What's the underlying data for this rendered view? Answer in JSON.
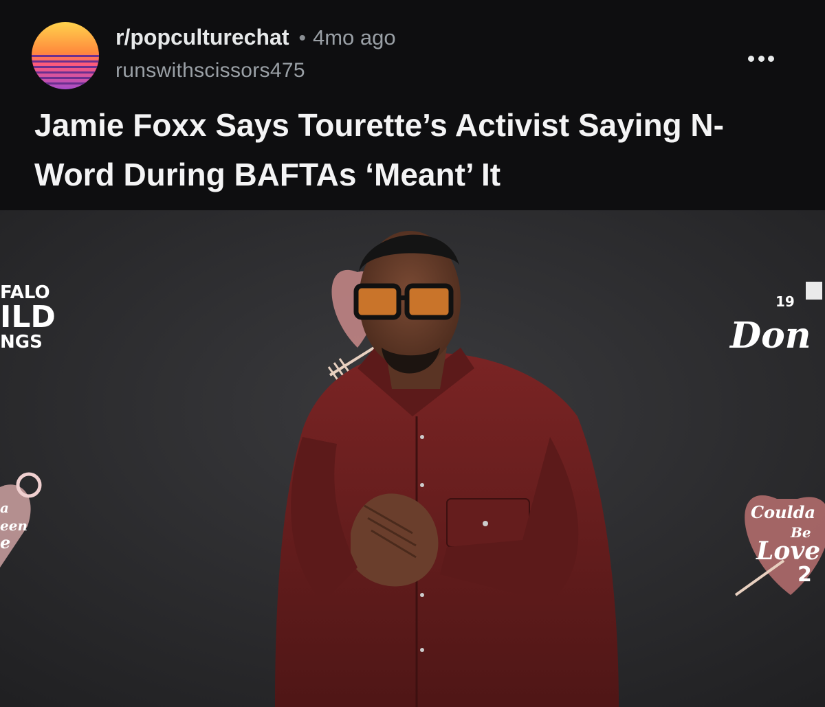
{
  "post": {
    "subreddit": "r/popculturechat",
    "separator": "•",
    "age": "4mo ago",
    "author": "runswithscissors475",
    "title": "Jamie Foxx Says Tourette’s Activist Saying N-Word During BAFTAs ‘Meant’ It",
    "more_icon": "more-horizontal-icon"
  },
  "image_backdrop": {
    "left_logo": [
      "FALO",
      "ILD",
      "NGS"
    ],
    "left_script": [
      "a",
      "een",
      "e"
    ],
    "right_top_number": "19",
    "right_wordmark": "Don",
    "right_script": [
      "Coulda",
      "Be",
      "Love",
      "2"
    ]
  },
  "colors": {
    "background": "#0e0e10",
    "title": "#f4f4f5",
    "muted": "#9aa0a6",
    "jacket": "#6b1f1f",
    "backdrop": "#2a2a2c"
  }
}
